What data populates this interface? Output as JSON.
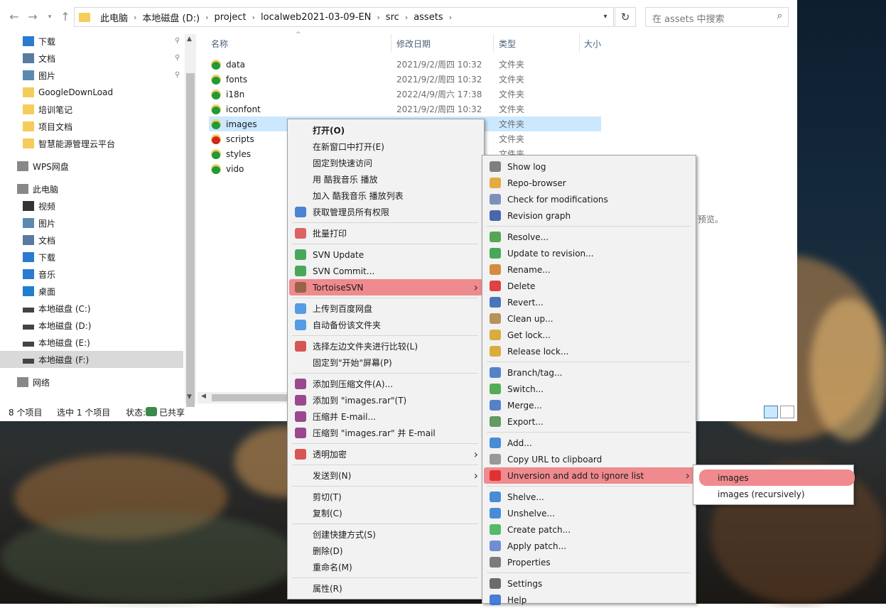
{
  "address": {
    "crumbs": [
      "此电脑",
      "本地磁盘 (D:)",
      "project",
      "localweb2021-03-09-EN",
      "src",
      "assets"
    ],
    "search_placeholder": "在 assets 中搜索"
  },
  "nav": {
    "quick": [
      {
        "label": "下载",
        "icon": "download-arrow-icon",
        "pinned": true
      },
      {
        "label": "文档",
        "icon": "document-icon",
        "pinned": true
      },
      {
        "label": "图片",
        "icon": "picture-icon",
        "pinned": true
      },
      {
        "label": "GoogleDownLoad",
        "icon": "folder-icon"
      },
      {
        "label": "培训笔记",
        "icon": "folder-icon"
      },
      {
        "label": "项目文档",
        "icon": "folder-icon"
      },
      {
        "label": "智慧能源管理云平台",
        "icon": "folder-icon"
      }
    ],
    "wps": "WPS网盘",
    "pc": "此电脑",
    "pc_items": [
      {
        "label": "视频",
        "icon": "video-icon"
      },
      {
        "label": "图片",
        "icon": "picture-icon"
      },
      {
        "label": "文档",
        "icon": "document-icon"
      },
      {
        "label": "下载",
        "icon": "download-arrow-icon"
      },
      {
        "label": "音乐",
        "icon": "music-note-icon"
      },
      {
        "label": "桌面",
        "icon": "desktop-icon"
      },
      {
        "label": "本地磁盘 (C:)",
        "icon": "drive-icon"
      },
      {
        "label": "本地磁盘 (D:)",
        "icon": "drive-icon",
        "selected": true
      },
      {
        "label": "本地磁盘 (E:)",
        "icon": "drive-icon"
      },
      {
        "label": "本地磁盘 (F:)",
        "icon": "drive-icon"
      }
    ],
    "network": "网络"
  },
  "columns": {
    "name": "名称",
    "date": "修改日期",
    "type": "类型",
    "size": "大小"
  },
  "files": [
    {
      "name": "data",
      "date": "2021/9/2/周四 10:32",
      "type": "文件夹",
      "status": "ok"
    },
    {
      "name": "fonts",
      "date": "2021/9/2/周四 10:32",
      "type": "文件夹",
      "status": "ok"
    },
    {
      "name": "i18n",
      "date": "2022/4/9/周六 17:38",
      "type": "文件夹",
      "status": "ok"
    },
    {
      "name": "iconfont",
      "date": "2021/9/2/周四 10:32",
      "type": "文件夹",
      "status": "ok"
    },
    {
      "name": "images",
      "date": "",
      "type": "文件夹",
      "status": "ok",
      "selected": true
    },
    {
      "name": "scripts",
      "date": "",
      "type": "文件夹",
      "status": "modified"
    },
    {
      "name": "styles",
      "date": "",
      "type": "文件夹",
      "status": "ok"
    },
    {
      "name": "vido",
      "date": "",
      "type": "",
      "status": "ok"
    }
  ],
  "preview_hint": "预览。",
  "status": {
    "count": "8 个项目",
    "selected": "选中 1 个项目",
    "state": "状态:",
    "shared": "已共享"
  },
  "context_menu": [
    {
      "label": "打开(O)",
      "bold": true
    },
    {
      "label": "在新窗口中打开(E)"
    },
    {
      "label": "固定到快速访问"
    },
    {
      "label": "用 酷我音乐 播放"
    },
    {
      "label": "加入 酷我音乐 播放列表"
    },
    {
      "label": "获取管理员所有权限",
      "icon": "shield-icon"
    },
    {
      "sep": true
    },
    {
      "label": "批量打印",
      "icon": "printer-icon"
    },
    {
      "sep": true
    },
    {
      "label": "SVN Update",
      "icon": "svn-update-icon"
    },
    {
      "label": "SVN Commit...",
      "icon": "svn-commit-icon"
    },
    {
      "label": "TortoiseSVN",
      "icon": "tortoise-icon",
      "submenu": true,
      "highlight": true
    },
    {
      "sep": true
    },
    {
      "label": "上传到百度网盘",
      "icon": "baidu-cloud-icon"
    },
    {
      "label": "自动备份该文件夹",
      "icon": "baidu-cloud-icon"
    },
    {
      "sep": true
    },
    {
      "label": "选择左边文件夹进行比较(L)",
      "icon": "compare-icon"
    },
    {
      "label": "固定到\"开始\"屏幕(P)"
    },
    {
      "sep": true
    },
    {
      "label": "添加到压缩文件(A)...",
      "icon": "winrar-icon"
    },
    {
      "label": "添加到 \"images.rar\"(T)",
      "icon": "winrar-icon"
    },
    {
      "label": "压缩并 E-mail...",
      "icon": "winrar-icon"
    },
    {
      "label": "压缩到 \"images.rar\" 并 E-mail",
      "icon": "winrar-icon"
    },
    {
      "sep": true
    },
    {
      "label": "透明加密",
      "icon": "encrypt-icon",
      "submenu": true
    },
    {
      "sep": true
    },
    {
      "label": "发送到(N)",
      "submenu": true
    },
    {
      "sep": true
    },
    {
      "label": "剪切(T)"
    },
    {
      "label": "复制(C)"
    },
    {
      "sep": true
    },
    {
      "label": "创建快捷方式(S)"
    },
    {
      "label": "删除(D)"
    },
    {
      "label": "重命名(M)"
    },
    {
      "sep": true
    },
    {
      "label": "属性(R)"
    }
  ],
  "svn_menu": [
    {
      "label": "Show log",
      "icon": "log-icon"
    },
    {
      "label": "Repo-browser",
      "icon": "repo-browser-icon"
    },
    {
      "label": "Check for modifications",
      "icon": "check-modifications-icon"
    },
    {
      "label": "Revision graph",
      "icon": "revision-graph-icon"
    },
    {
      "sep": true
    },
    {
      "label": "Resolve...",
      "icon": "resolve-icon"
    },
    {
      "label": "Update to revision...",
      "icon": "update-icon"
    },
    {
      "label": "Rename...",
      "icon": "rename-icon"
    },
    {
      "label": "Delete",
      "icon": "delete-icon"
    },
    {
      "label": "Revert...",
      "icon": "revert-icon"
    },
    {
      "label": "Clean up...",
      "icon": "cleanup-icon"
    },
    {
      "label": "Get lock...",
      "icon": "lock-icon"
    },
    {
      "label": "Release lock...",
      "icon": "unlock-icon"
    },
    {
      "sep": true
    },
    {
      "label": "Branch/tag...",
      "icon": "branch-icon"
    },
    {
      "label": "Switch...",
      "icon": "switch-icon"
    },
    {
      "label": "Merge...",
      "icon": "merge-icon"
    },
    {
      "label": "Export...",
      "icon": "export-icon"
    },
    {
      "sep": true
    },
    {
      "label": "Add...",
      "icon": "add-icon"
    },
    {
      "label": "Copy URL to clipboard",
      "icon": "copy-icon"
    },
    {
      "label": "Unversion and add to ignore list",
      "icon": "ignore-icon",
      "submenu": true,
      "highlight": true
    },
    {
      "sep": true
    },
    {
      "label": "Shelve...",
      "icon": "shelve-icon"
    },
    {
      "label": "Unshelve...",
      "icon": "unshelve-icon"
    },
    {
      "label": "Create patch...",
      "icon": "create-patch-icon"
    },
    {
      "label": "Apply patch...",
      "icon": "apply-patch-icon"
    },
    {
      "label": "Properties",
      "icon": "properties-icon"
    },
    {
      "sep": true
    },
    {
      "label": "Settings",
      "icon": "settings-icon"
    },
    {
      "label": "Help",
      "icon": "help-icon"
    }
  ],
  "ignore_menu": [
    {
      "label": "images",
      "highlight": true
    },
    {
      "label": "images (recursively)"
    }
  ]
}
